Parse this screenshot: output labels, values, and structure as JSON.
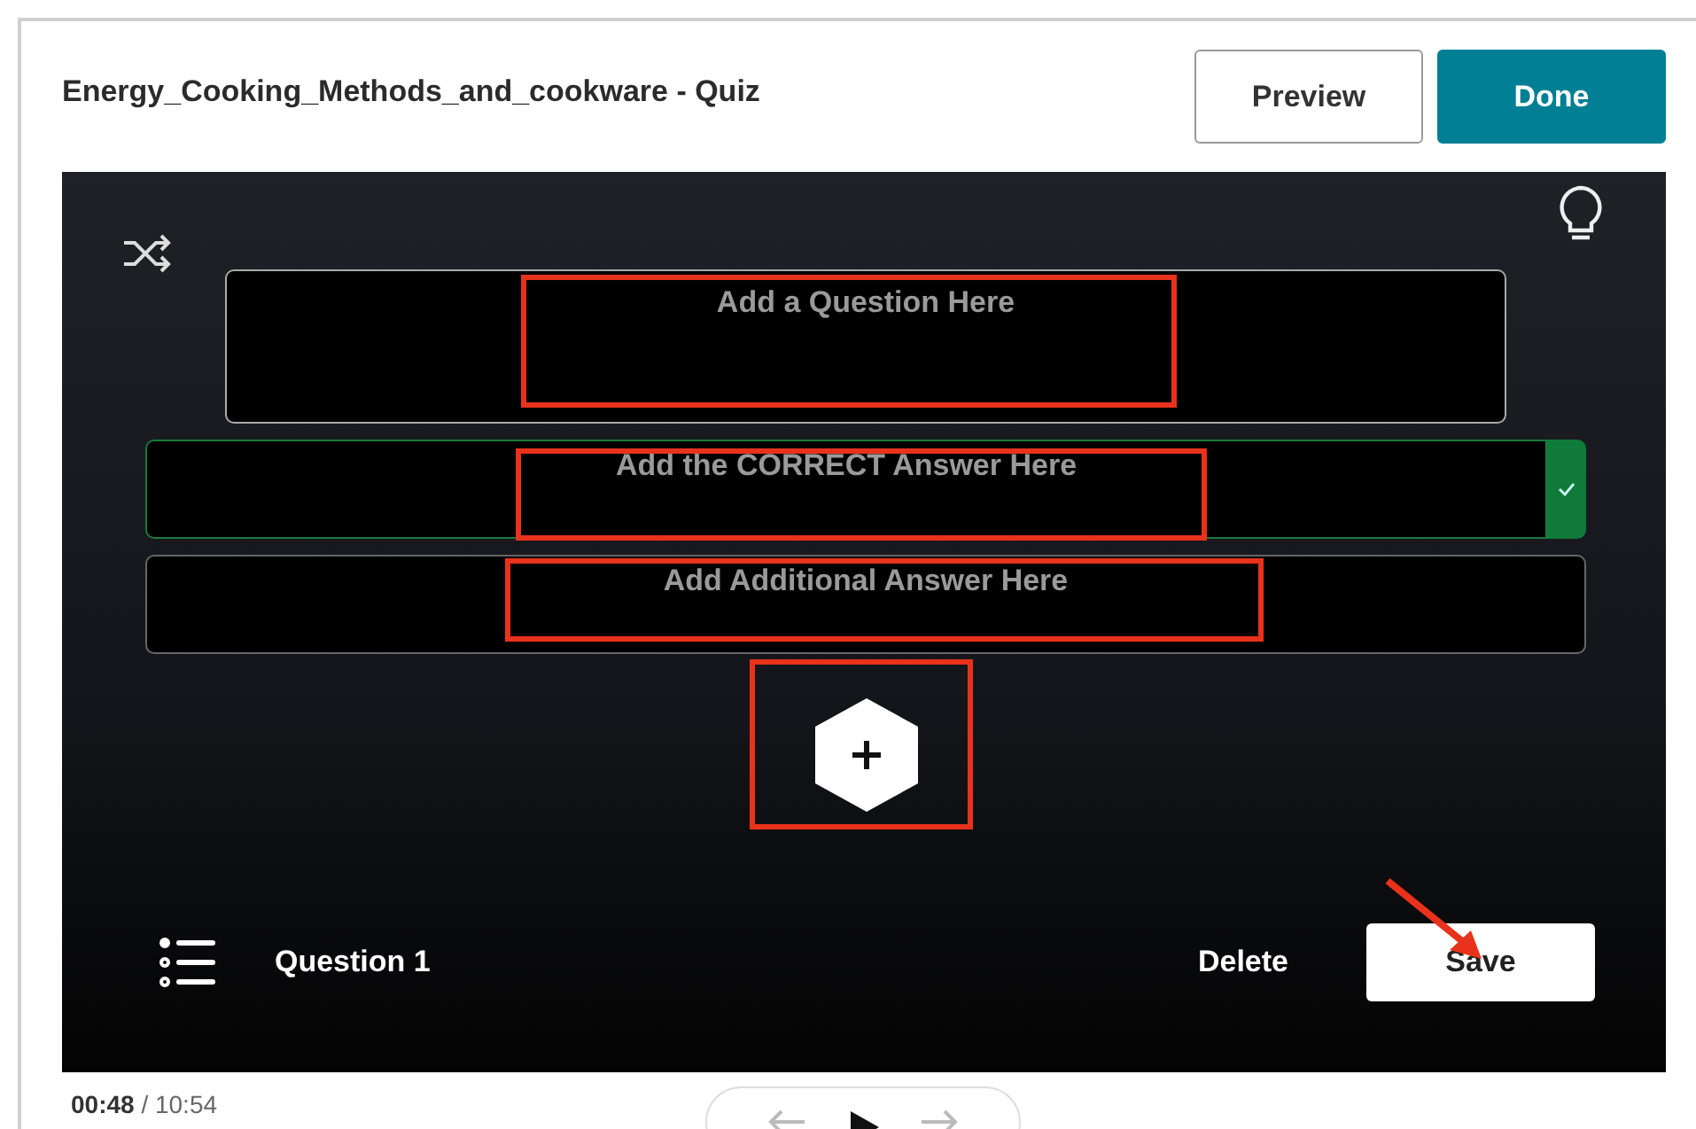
{
  "header": {
    "title": "Energy_Cooking_Methods_and_cookware - Quiz",
    "buttons": [
      {
        "label": "Preview",
        "kind": "secondary"
      },
      {
        "label": "Done",
        "kind": "primary"
      }
    ]
  },
  "question": {
    "placeholder": "Add a Question Here"
  },
  "answers": [
    {
      "placeholder": "Add the CORRECT Answer Here",
      "correct": true
    },
    {
      "placeholder": "Add Additional Answer Here",
      "correct": false
    }
  ],
  "footer": {
    "question_label": "Question 1",
    "delete": "Delete",
    "save": "Save"
  },
  "player": {
    "current_time": "00:48",
    "separator": "/",
    "duration": "10:54"
  }
}
